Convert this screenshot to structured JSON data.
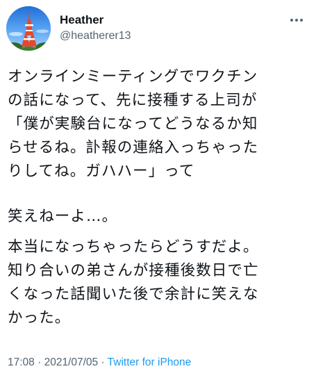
{
  "author": {
    "display_name": "Heather",
    "handle": "@heatherer13",
    "avatar_icon": "tokyo-tower-avatar"
  },
  "more_icon": "more-options-icon",
  "tweet": {
    "paragraph_1": [
      "オンラインミーティングでワクチン",
      "の話になって、先に接種する上司が",
      "「僕が実験台になってどうなるか知",
      "らせるね。訃報の連絡入っちゃった",
      "りしてね。ガハハー」って"
    ],
    "paragraph_2": [
      "笑えねーよ…。"
    ],
    "paragraph_3": [
      "本当になっちゃったらどうすだよ。",
      "知り合いの弟さんが接種後数日で亡",
      "くなった話聞いた後で余計に笑えな",
      "かった。"
    ]
  },
  "meta": {
    "time": "17:08",
    "separator_1": " · ",
    "date": "2021/07/05",
    "separator_2": " · ",
    "source": "Twitter for iPhone"
  },
  "colors": {
    "text": "#0f1419",
    "secondary": "#536471",
    "link": "#1d9bf0"
  }
}
